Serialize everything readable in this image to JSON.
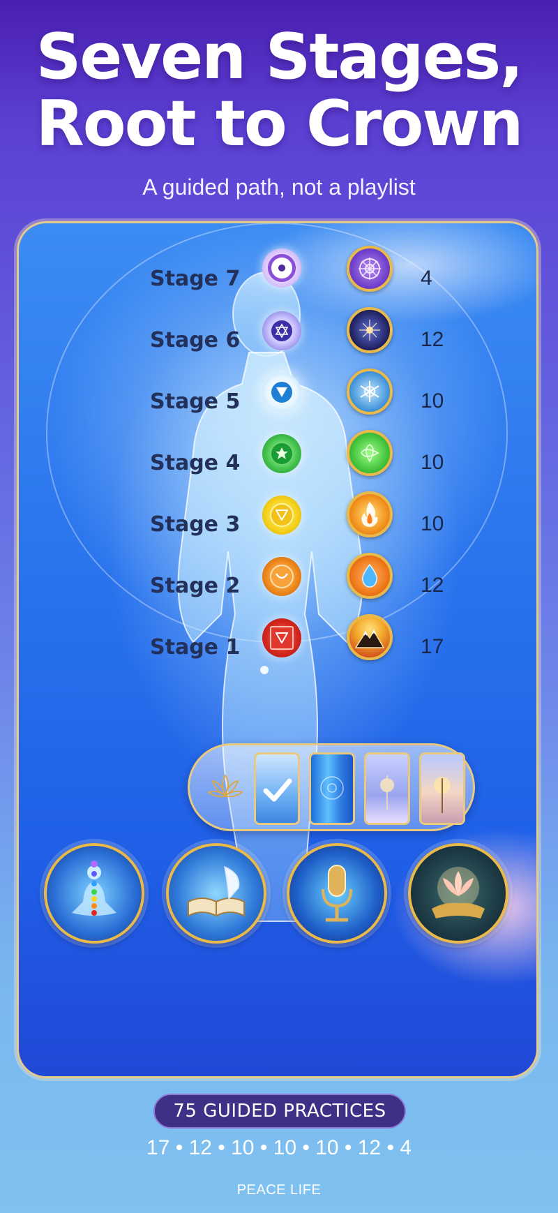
{
  "header": {
    "title_line1": "Seven Stages,",
    "title_line2": "Root to Crown",
    "subtitle": "A guided path, not a playlist"
  },
  "stages": [
    {
      "label": "Stage 7",
      "count": "4",
      "color": "#8a4fd8",
      "medal_icon": "crown-mandala-icon"
    },
    {
      "label": "Stage 6",
      "count": "12",
      "color": "#4b3fb8",
      "medal_icon": "third-eye-star-icon"
    },
    {
      "label": "Stage 5",
      "count": "10",
      "color": "#1e7fd6",
      "medal_icon": "throat-snowflake-icon"
    },
    {
      "label": "Stage 4",
      "count": "10",
      "color": "#2fb54a",
      "medal_icon": "heart-leaf-icon"
    },
    {
      "label": "Stage 3",
      "count": "10",
      "color": "#f2c21b",
      "medal_icon": "fire-icon"
    },
    {
      "label": "Stage 2",
      "count": "12",
      "color": "#f08a1c",
      "medal_icon": "water-drop-icon"
    },
    {
      "label": "Stage 1",
      "count": "17",
      "color": "#d7281f",
      "medal_icon": "mountain-icon"
    }
  ],
  "selector": {
    "lotus_icon": "lotus-icon",
    "thumbnails": [
      "thumb-sky-selected",
      "thumb-waterfall",
      "thumb-meditation-light",
      "thumb-sunset-figure"
    ],
    "selected_index": 0
  },
  "features": [
    {
      "name": "chakra-meditation",
      "icon": "meditation-figure-icon"
    },
    {
      "name": "journal",
      "icon": "book-quill-icon"
    },
    {
      "name": "audio",
      "icon": "microphone-icon"
    },
    {
      "name": "lotus",
      "icon": "lotus-hands-icon"
    }
  ],
  "footer": {
    "practices_label": "75 GUIDED PRACTICES",
    "breakdown": "17 • 12 • 10 • 10 • 10 • 12 • 4",
    "brand": "PEACE LIFE"
  }
}
